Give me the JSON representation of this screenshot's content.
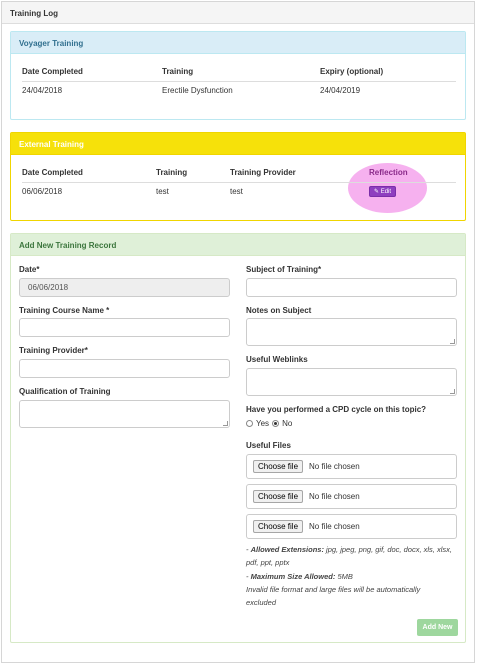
{
  "page": {
    "title": "Training Log"
  },
  "voyager": {
    "title": "Voyager Training",
    "headers": [
      "Date Completed",
      "Training",
      "Expiry (optional)"
    ],
    "rows": [
      [
        "24/04/2018",
        "Erectile Dysfunction",
        "24/04/2019"
      ]
    ]
  },
  "external": {
    "title": "External Training",
    "headers": [
      "Date Completed",
      "Training",
      "Training Provider",
      "Reflection"
    ],
    "rows": [
      [
        "06/06/2018",
        "test",
        "test"
      ]
    ],
    "edit_label": "Edit"
  },
  "form": {
    "title": "Add New Training Record",
    "date_label": "Date*",
    "date_value": "06/06/2018",
    "course_label": "Training Course Name *",
    "provider_label": "Training Provider*",
    "qualification_label": "Qualification of Training",
    "subject_label": "Subject of Training*",
    "notes_label": "Notes on Subject",
    "weblinks_label": "Useful Weblinks",
    "cpd_question": "Have you performed a CPD cycle on this topic?",
    "cpd_yes": "Yes",
    "cpd_no": "No",
    "cpd_selected": "No",
    "files_label": "Useful Files",
    "choose_file": "Choose file",
    "no_file": "No file chosen",
    "allowed_ext_label": "Allowed Extensions:",
    "allowed_ext_value": "jpg, jpeg, png, gif, doc, docx, xls, xlsx, pdf, ppt, pptx",
    "max_size_label": "Maximum Size Allowed:",
    "max_size_value": "5MB",
    "invalid_note": "Invalid file format and large files will be automatically excluded",
    "add_button": "Add New"
  },
  "colors": {
    "info_head": "#d9edf7",
    "warning_head": "#f6e10a",
    "success_head": "#dff0d8",
    "highlight": "#f5a3ec",
    "edit_button": "#8e3fbf",
    "add_button": "#9ed79e"
  },
  "icons": {
    "edit": "pencil-icon"
  }
}
